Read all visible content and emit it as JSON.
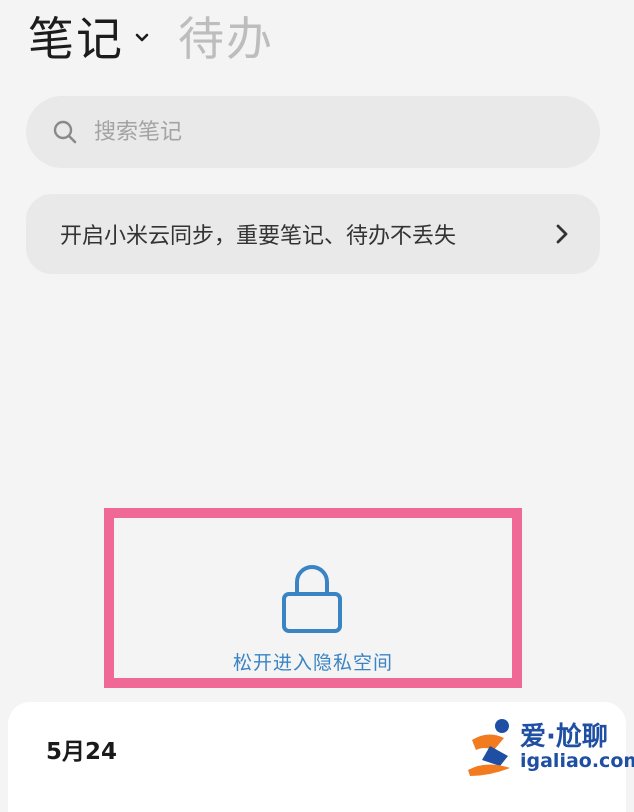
{
  "header": {
    "notes_tab": "笔记",
    "todo_tab": "待办"
  },
  "search": {
    "placeholder": "搜索笔记"
  },
  "sync_banner": {
    "text": "开启小米云同步，重要笔记、待办不丢失"
  },
  "privacy": {
    "label": "松开进入隐私空间",
    "accent_color": "#3a84c4",
    "highlight_color": "#f06895"
  },
  "notes": {
    "date_header": "5月24"
  },
  "watermark": {
    "name": "爱·尬聊",
    "url": "igaliao.com"
  },
  "icons": {
    "notes_dropdown": "chevron-down-icon",
    "search": "search-icon",
    "banner_arrow": "chevron-right-icon",
    "privacy": "lock-icon"
  }
}
